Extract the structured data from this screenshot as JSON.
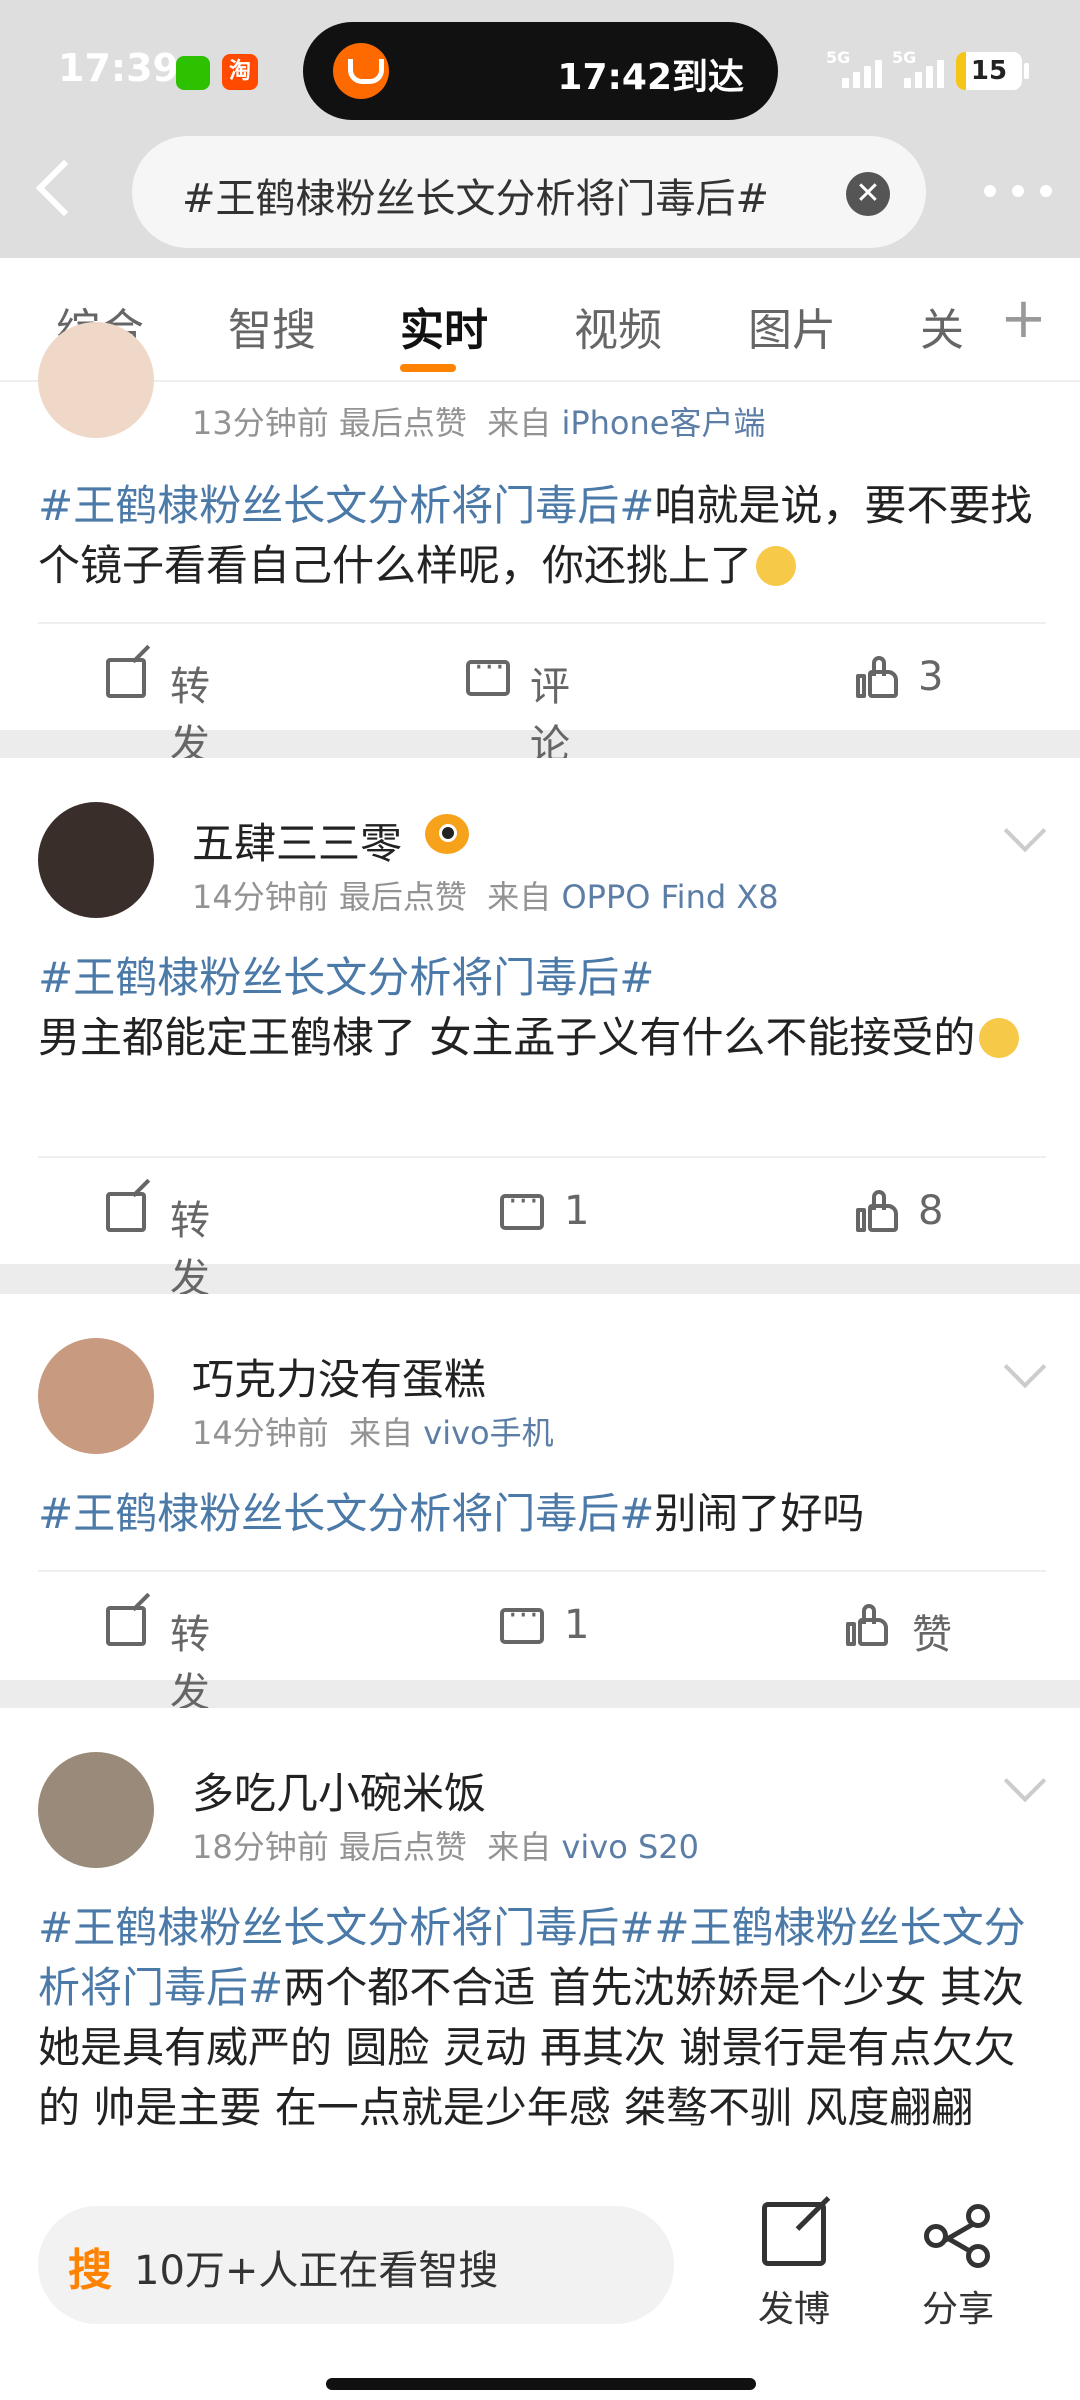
{
  "status_bar": {
    "time": "17:39",
    "island_text": "17:42到达",
    "signal1": "5G",
    "signal2": "5G",
    "battery_level": "15",
    "taobao_icon_text": "淘"
  },
  "search": {
    "query": "#王鹤棣粉丝长文分析将门毒后#",
    "clear_icon": "✕"
  },
  "tabs": [
    {
      "label": "综合"
    },
    {
      "label": "智搜"
    },
    {
      "label": "实时",
      "active": true
    },
    {
      "label": "视频"
    },
    {
      "label": "图片"
    },
    {
      "label": "关"
    }
  ],
  "add_tab": "+",
  "posts": [
    {
      "username": "",
      "time": "13分钟前",
      "extra": "最后点赞",
      "from_label": "来自",
      "source": "iPhone客户端",
      "topic": "#王鹤棣粉丝长文分析将门毒后#",
      "text": "咱就是说，要不要找个镜子看看自己什么样呢，你还挑上了",
      "repost": "转发",
      "comment": "评论",
      "likes": "3"
    },
    {
      "username": "五肆三三零",
      "time": "14分钟前",
      "extra": "最后点赞",
      "from_label": "来自",
      "source": "OPPO Find X8",
      "topic": "#王鹤棣粉丝长文分析将门毒后#",
      "text": "男主都能定王鹤棣了 女主孟子义有什么不能接受的",
      "repost": "转发",
      "comment": "1",
      "likes": "8"
    },
    {
      "username": "巧克力没有蛋糕",
      "time": "14分钟前",
      "extra": "",
      "from_label": "来自",
      "source": "vivo手机",
      "topic": "#王鹤棣粉丝长文分析将门毒后#",
      "text": "别闹了好吗",
      "repost": "转发",
      "comment": "1",
      "likes": "赞"
    },
    {
      "username": "多吃几小碗米饭",
      "time": "18分钟前",
      "extra": "最后点赞",
      "from_label": "来自",
      "source": "vivo S20",
      "topic": "#王鹤棣粉丝长文分析将门毒后##王鹤棣粉丝长文分析将门毒后#",
      "text": "两个都不合适 首先沈娇娇是个少女 其次她是具有威严的 圆脸 灵动 再其次 谢景行是有点欠欠的 帅是主要 在一点就是少年感 桀骜不驯 风度翩翩"
    }
  ],
  "bottom_bar": {
    "ai_logo": "搜",
    "ai_text": "10万+人正在看智搜",
    "post_label": "发博",
    "share_label": "分享"
  },
  "colors": {
    "accent": "#ff8200",
    "topic": "#4b79a8",
    "source": "#5b7da6",
    "meta": "#939393"
  }
}
